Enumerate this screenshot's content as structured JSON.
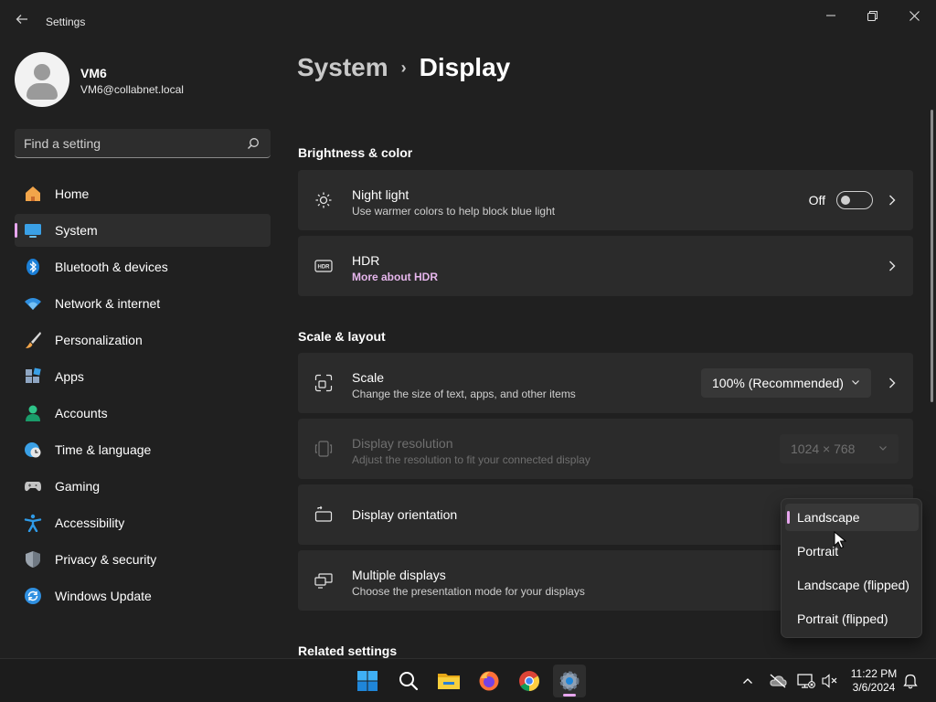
{
  "window": {
    "title": "Settings"
  },
  "profile": {
    "name": "VM6",
    "email": "VM6@collabnet.local"
  },
  "search": {
    "placeholder": "Find a setting",
    "value": ""
  },
  "sidebar": {
    "items": [
      {
        "label": "Home",
        "icon": "home-icon"
      },
      {
        "label": "System",
        "icon": "system-icon",
        "active": true
      },
      {
        "label": "Bluetooth & devices",
        "icon": "bluetooth-icon"
      },
      {
        "label": "Network & internet",
        "icon": "wifi-icon"
      },
      {
        "label": "Personalization",
        "icon": "brush-icon"
      },
      {
        "label": "Apps",
        "icon": "apps-icon"
      },
      {
        "label": "Accounts",
        "icon": "accounts-icon"
      },
      {
        "label": "Time & language",
        "icon": "globe-clock-icon"
      },
      {
        "label": "Gaming",
        "icon": "gamepad-icon"
      },
      {
        "label": "Accessibility",
        "icon": "accessibility-icon"
      },
      {
        "label": "Privacy & security",
        "icon": "shield-icon"
      },
      {
        "label": "Windows Update",
        "icon": "update-icon"
      }
    ]
  },
  "breadcrumb": {
    "parent": "System",
    "separator": "›",
    "current": "Display"
  },
  "sections": {
    "brightness": "Brightness & color",
    "scale_layout": "Scale & layout",
    "related": "Related settings"
  },
  "cards": {
    "night_light": {
      "title": "Night light",
      "subtitle": "Use warmer colors to help block blue light",
      "state_label": "Off",
      "on": false
    },
    "hdr": {
      "title": "HDR",
      "link": "More about HDR"
    },
    "scale": {
      "title": "Scale",
      "subtitle": "Change the size of text, apps, and other items",
      "value": "100% (Recommended)"
    },
    "resolution": {
      "title": "Display resolution",
      "subtitle": "Adjust the resolution to fit your connected display",
      "value": "1024 × 768",
      "disabled": true
    },
    "orientation": {
      "title": "Display orientation"
    },
    "multiple": {
      "title": "Multiple displays",
      "subtitle": "Choose the presentation mode for your displays"
    }
  },
  "orientation_menu": {
    "options": [
      "Landscape",
      "Portrait",
      "Landscape (flipped)",
      "Portrait (flipped)"
    ],
    "selected": "Landscape"
  },
  "taskbar": {
    "apps": [
      "start-icon",
      "search-icon",
      "file-explorer-icon",
      "firefox-icon",
      "chrome-icon",
      "settings-icon"
    ],
    "active_app": "settings-icon",
    "time": "11:22 PM",
    "date": "3/6/2024"
  },
  "colors": {
    "accent": "#e8a6ef",
    "background": "#202020",
    "card": "#2b2b2b"
  }
}
